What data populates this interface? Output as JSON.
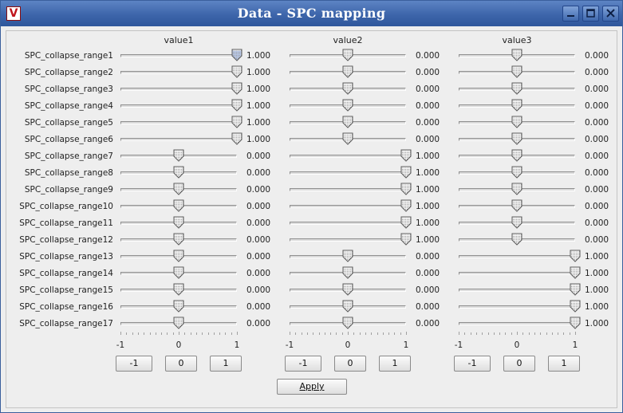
{
  "window": {
    "title": "Data - SPC mapping",
    "app_icon_glyph": "V"
  },
  "columns": [
    {
      "header": "value1",
      "values": [
        1,
        1,
        1,
        1,
        1,
        1,
        0,
        0,
        0,
        0,
        0,
        0,
        0,
        0,
        0,
        0,
        0
      ]
    },
    {
      "header": "value2",
      "values": [
        0,
        0,
        0,
        0,
        0,
        0,
        1,
        1,
        1,
        1,
        1,
        1,
        0,
        0,
        0,
        0,
        0
      ]
    },
    {
      "header": "value3",
      "values": [
        0,
        0,
        0,
        0,
        0,
        0,
        0,
        0,
        0,
        0,
        0,
        0,
        1,
        1,
        1,
        1,
        1
      ]
    }
  ],
  "rows": [
    "SPC_collapse_range1",
    "SPC_collapse_range2",
    "SPC_collapse_range3",
    "SPC_collapse_range4",
    "SPC_collapse_range5",
    "SPC_collapse_range6",
    "SPC_collapse_range7",
    "SPC_collapse_range8",
    "SPC_collapse_range9",
    "SPC_collapse_range10",
    "SPC_collapse_range11",
    "SPC_collapse_range12",
    "SPC_collapse_range13",
    "SPC_collapse_range14",
    "SPC_collapse_range15",
    "SPC_collapse_range16",
    "SPC_collapse_range17"
  ],
  "slider_range": {
    "min": -1,
    "max": 1
  },
  "tick_labels": [
    "-1",
    "0",
    "1"
  ],
  "set_buttons": [
    "-1",
    "0",
    "1"
  ],
  "apply_label": "Apply",
  "focused_slider": {
    "row": 0,
    "col": 0
  },
  "colors": {
    "titlebar": "#3d65aa",
    "background": "#eeeeee",
    "focus": "#b8c8e8"
  }
}
